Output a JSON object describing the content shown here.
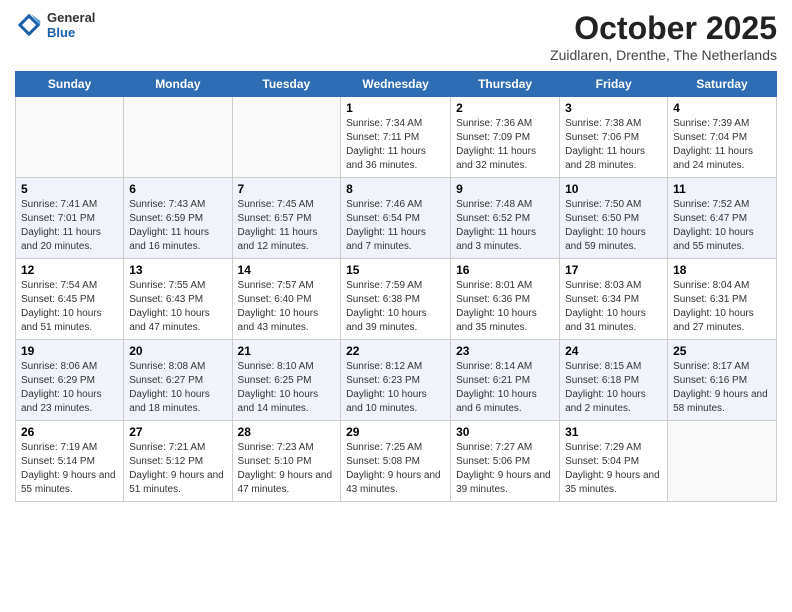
{
  "header": {
    "logo_general": "General",
    "logo_blue": "Blue",
    "month_year": "October 2025",
    "location": "Zuidlaren, Drenthe, The Netherlands"
  },
  "days_of_week": [
    "Sunday",
    "Monday",
    "Tuesday",
    "Wednesday",
    "Thursday",
    "Friday",
    "Saturday"
  ],
  "weeks": [
    [
      {
        "day": "",
        "info": ""
      },
      {
        "day": "",
        "info": ""
      },
      {
        "day": "",
        "info": ""
      },
      {
        "day": "1",
        "info": "Sunrise: 7:34 AM\nSunset: 7:11 PM\nDaylight: 11 hours and 36 minutes."
      },
      {
        "day": "2",
        "info": "Sunrise: 7:36 AM\nSunset: 7:09 PM\nDaylight: 11 hours and 32 minutes."
      },
      {
        "day": "3",
        "info": "Sunrise: 7:38 AM\nSunset: 7:06 PM\nDaylight: 11 hours and 28 minutes."
      },
      {
        "day": "4",
        "info": "Sunrise: 7:39 AM\nSunset: 7:04 PM\nDaylight: 11 hours and 24 minutes."
      }
    ],
    [
      {
        "day": "5",
        "info": "Sunrise: 7:41 AM\nSunset: 7:01 PM\nDaylight: 11 hours and 20 minutes."
      },
      {
        "day": "6",
        "info": "Sunrise: 7:43 AM\nSunset: 6:59 PM\nDaylight: 11 hours and 16 minutes."
      },
      {
        "day": "7",
        "info": "Sunrise: 7:45 AM\nSunset: 6:57 PM\nDaylight: 11 hours and 12 minutes."
      },
      {
        "day": "8",
        "info": "Sunrise: 7:46 AM\nSunset: 6:54 PM\nDaylight: 11 hours and 7 minutes."
      },
      {
        "day": "9",
        "info": "Sunrise: 7:48 AM\nSunset: 6:52 PM\nDaylight: 11 hours and 3 minutes."
      },
      {
        "day": "10",
        "info": "Sunrise: 7:50 AM\nSunset: 6:50 PM\nDaylight: 10 hours and 59 minutes."
      },
      {
        "day": "11",
        "info": "Sunrise: 7:52 AM\nSunset: 6:47 PM\nDaylight: 10 hours and 55 minutes."
      }
    ],
    [
      {
        "day": "12",
        "info": "Sunrise: 7:54 AM\nSunset: 6:45 PM\nDaylight: 10 hours and 51 minutes."
      },
      {
        "day": "13",
        "info": "Sunrise: 7:55 AM\nSunset: 6:43 PM\nDaylight: 10 hours and 47 minutes."
      },
      {
        "day": "14",
        "info": "Sunrise: 7:57 AM\nSunset: 6:40 PM\nDaylight: 10 hours and 43 minutes."
      },
      {
        "day": "15",
        "info": "Sunrise: 7:59 AM\nSunset: 6:38 PM\nDaylight: 10 hours and 39 minutes."
      },
      {
        "day": "16",
        "info": "Sunrise: 8:01 AM\nSunset: 6:36 PM\nDaylight: 10 hours and 35 minutes."
      },
      {
        "day": "17",
        "info": "Sunrise: 8:03 AM\nSunset: 6:34 PM\nDaylight: 10 hours and 31 minutes."
      },
      {
        "day": "18",
        "info": "Sunrise: 8:04 AM\nSunset: 6:31 PM\nDaylight: 10 hours and 27 minutes."
      }
    ],
    [
      {
        "day": "19",
        "info": "Sunrise: 8:06 AM\nSunset: 6:29 PM\nDaylight: 10 hours and 23 minutes."
      },
      {
        "day": "20",
        "info": "Sunrise: 8:08 AM\nSunset: 6:27 PM\nDaylight: 10 hours and 18 minutes."
      },
      {
        "day": "21",
        "info": "Sunrise: 8:10 AM\nSunset: 6:25 PM\nDaylight: 10 hours and 14 minutes."
      },
      {
        "day": "22",
        "info": "Sunrise: 8:12 AM\nSunset: 6:23 PM\nDaylight: 10 hours and 10 minutes."
      },
      {
        "day": "23",
        "info": "Sunrise: 8:14 AM\nSunset: 6:21 PM\nDaylight: 10 hours and 6 minutes."
      },
      {
        "day": "24",
        "info": "Sunrise: 8:15 AM\nSunset: 6:18 PM\nDaylight: 10 hours and 2 minutes."
      },
      {
        "day": "25",
        "info": "Sunrise: 8:17 AM\nSunset: 6:16 PM\nDaylight: 9 hours and 58 minutes."
      }
    ],
    [
      {
        "day": "26",
        "info": "Sunrise: 7:19 AM\nSunset: 5:14 PM\nDaylight: 9 hours and 55 minutes."
      },
      {
        "day": "27",
        "info": "Sunrise: 7:21 AM\nSunset: 5:12 PM\nDaylight: 9 hours and 51 minutes."
      },
      {
        "day": "28",
        "info": "Sunrise: 7:23 AM\nSunset: 5:10 PM\nDaylight: 9 hours and 47 minutes."
      },
      {
        "day": "29",
        "info": "Sunrise: 7:25 AM\nSunset: 5:08 PM\nDaylight: 9 hours and 43 minutes."
      },
      {
        "day": "30",
        "info": "Sunrise: 7:27 AM\nSunset: 5:06 PM\nDaylight: 9 hours and 39 minutes."
      },
      {
        "day": "31",
        "info": "Sunrise: 7:29 AM\nSunset: 5:04 PM\nDaylight: 9 hours and 35 minutes."
      },
      {
        "day": "",
        "info": ""
      }
    ]
  ]
}
